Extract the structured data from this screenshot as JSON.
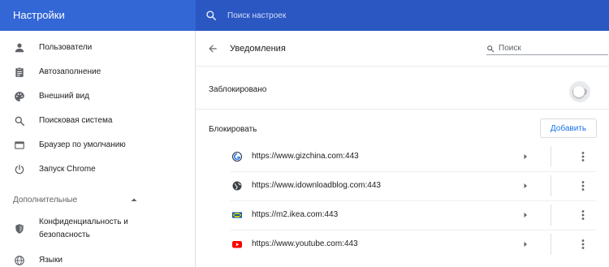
{
  "header": {
    "title": "Настройки",
    "search_placeholder": "Поиск настроек"
  },
  "sidebar": {
    "items": [
      {
        "label": "Пользователи",
        "icon": "person-icon"
      },
      {
        "label": "Автозаполнение",
        "icon": "clipboard-icon"
      },
      {
        "label": "Внешний вид",
        "icon": "palette-icon"
      },
      {
        "label": "Поисковая система",
        "icon": "search-icon"
      },
      {
        "label": "Браузер по умолчанию",
        "icon": "browser-icon"
      },
      {
        "label": "Запуск Chrome",
        "icon": "power-icon"
      }
    ],
    "advanced_label": "Дополнительные",
    "advanced_items": [
      {
        "label_line1": "Конфиденциальность и",
        "label_line2": "безопасность",
        "icon": "shield-icon"
      },
      {
        "label": "Языки",
        "icon": "globe-icon"
      }
    ]
  },
  "main": {
    "title": "Уведомления",
    "search_placeholder": "Поиск",
    "blocked_label": "Заблокировано",
    "blocked_enabled": false,
    "block_section_label": "Блокировать",
    "add_button_label": "Добавить",
    "sites": [
      {
        "url": "https://www.gizchina.com:443",
        "favicon": "gizchina-favicon"
      },
      {
        "url": "https://www.idownloadblog.com:443",
        "favicon": "globe-favicon"
      },
      {
        "url": "https://m2.ikea.com:443",
        "favicon": "ikea-favicon"
      },
      {
        "url": "https://www.youtube.com:443",
        "favicon": "youtube-favicon"
      }
    ]
  },
  "colors": {
    "header_bg": "#3367d6",
    "search_bg": "#2b57c2",
    "accent": "#1a73e8"
  }
}
